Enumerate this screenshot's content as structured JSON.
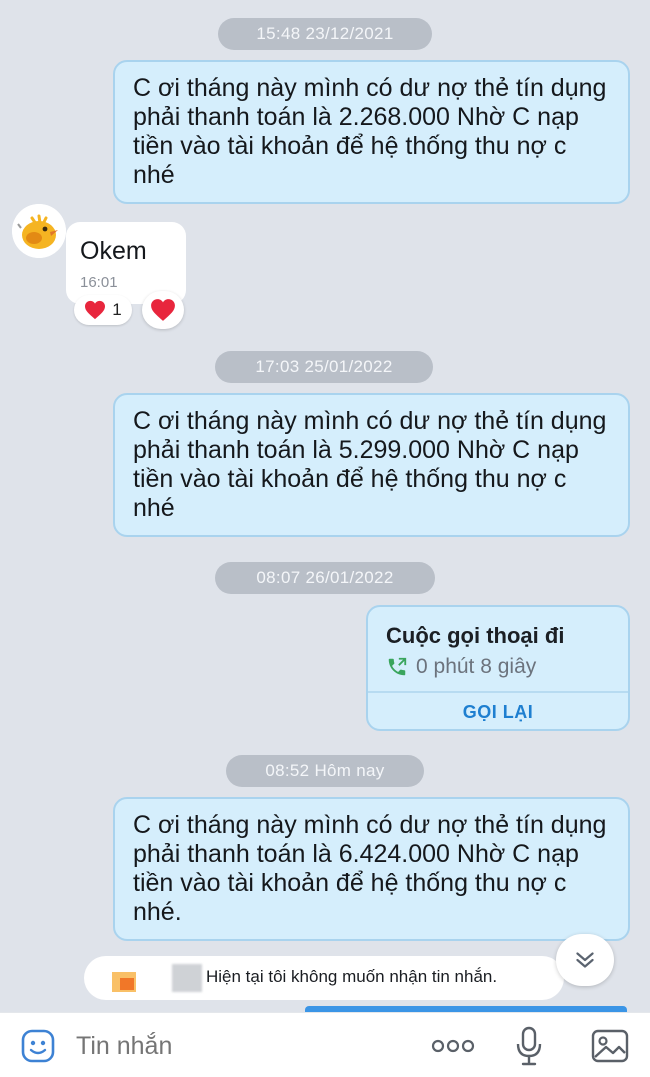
{
  "conversation": {
    "items": [
      {
        "time": "15:48 23/12/2021"
      },
      {
        "message": "C ơi tháng này mình có dư nợ thẻ tín dụng phải thanh toán  là 2.268.000 Nhờ C nạp tiền vào tài khoản để hệ thống thu nợ c nhé"
      },
      {
        "message": "Okem",
        "time": "16:01",
        "reaction_count": "1"
      },
      {
        "time": "17:03 25/01/2022"
      },
      {
        "message": "C ơi tháng này mình có dư nợ thẻ tín dụng phải thanh toán  là 5.299.000 Nhờ C nạp tiền vào tài khoản để hệ thống thu nợ c nhé"
      },
      {
        "time": "08:07 26/01/2022"
      },
      {
        "title": "Cuộc gọi thoại đi",
        "duration": "0 phút 8 giây",
        "action": "GỌI LẠI"
      },
      {
        "time": "08:52 Hôm nay"
      },
      {
        "message": "C ơi tháng này mình có dư nợ thẻ tín dụng phải thanh toán  là 6.424.000 Nhờ C nạp tiền vào tài khoản để hệ thống thu nợ c nhé."
      }
    ]
  },
  "reply_strip": {
    "text": "Hiện tại tôi không muốn nhận tin nhắn."
  },
  "composer": {
    "placeholder": "Tin nhắn"
  },
  "colors": {
    "outgoing_bubble": "#d5eefc",
    "accent": "#1e7fd0",
    "heart": "#e8263d"
  },
  "icons": [
    "emoji-icon",
    "more-icon",
    "microphone-icon",
    "gallery-icon",
    "chevron-double-down-icon",
    "heart-icon",
    "outgoing-call-icon"
  ]
}
